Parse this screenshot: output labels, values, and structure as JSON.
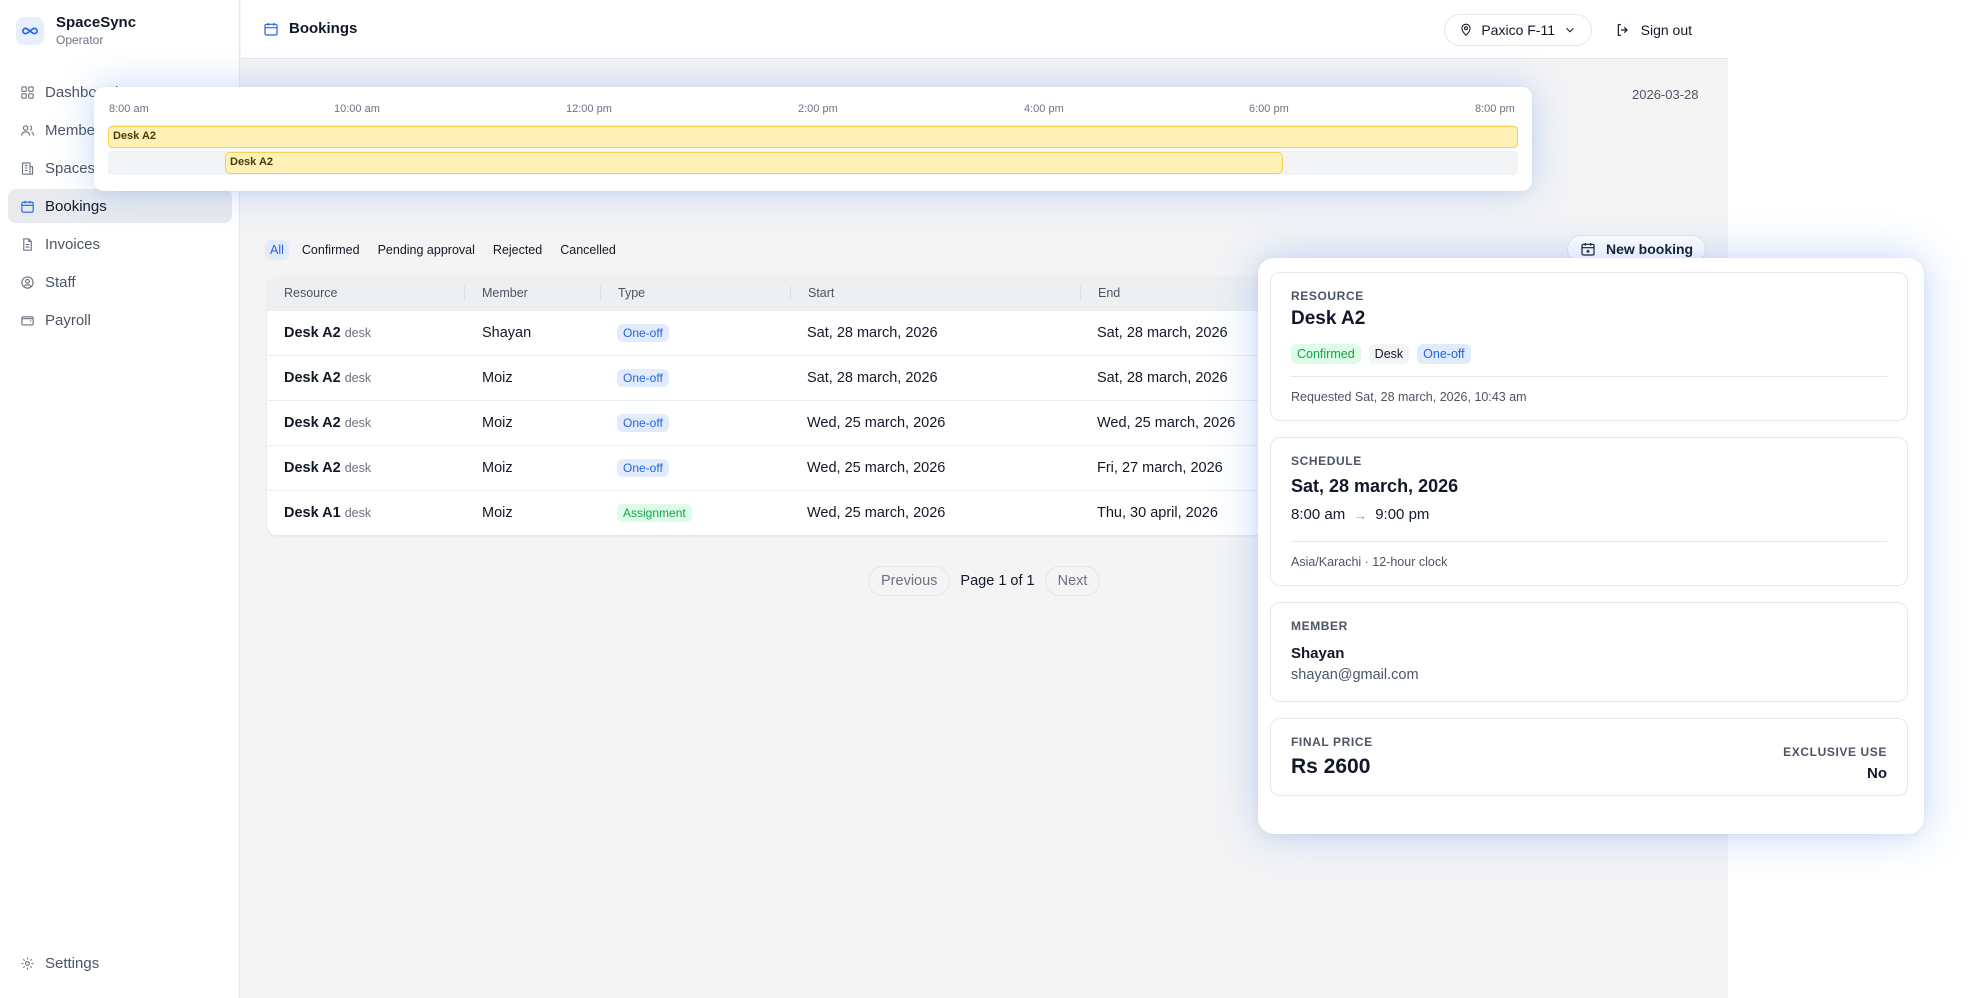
{
  "brand": {
    "name": "SpaceSync",
    "role": "Operator"
  },
  "sidebar": {
    "items": [
      {
        "label": "Dashboard",
        "icon": "grid-icon"
      },
      {
        "label": "Members",
        "icon": "users-icon"
      },
      {
        "label": "Spaces",
        "icon": "building-icon"
      },
      {
        "label": "Bookings",
        "icon": "calendar-icon",
        "active": true
      },
      {
        "label": "Invoices",
        "icon": "document-icon"
      },
      {
        "label": "Staff",
        "icon": "user-circle-icon"
      },
      {
        "label": "Payroll",
        "icon": "wallet-icon"
      }
    ],
    "settings_label": "Settings"
  },
  "header": {
    "title": "Bookings",
    "location": "Paxico F-11",
    "signout_label": "Sign out"
  },
  "timeline": {
    "date": "2026-03-28",
    "ticks": [
      "8:00 am",
      "10:00 am",
      "12:00 pm",
      "2:00 pm",
      "4:00 pm",
      "6:00 pm",
      "8:00 pm"
    ],
    "bookings": [
      {
        "label": "Desk A2",
        "start": "8:00 am",
        "end": "8:00 pm"
      },
      {
        "label": "Desk A2",
        "start": "9:00 am",
        "end": "6:00 pm"
      }
    ]
  },
  "filters": [
    "All",
    "Confirmed",
    "Pending approval",
    "Rejected",
    "Cancelled"
  ],
  "new_booking_label": "New booking",
  "table": {
    "columns": [
      "Resource",
      "Member",
      "Type",
      "Start",
      "End"
    ],
    "rows": [
      {
        "resource": "Desk A2",
        "kind": "desk",
        "member": "Shayan",
        "type": "One-off",
        "start": "Sat, 28 march, 2026",
        "end": "Sat, 28 march, 2026"
      },
      {
        "resource": "Desk A2",
        "kind": "desk",
        "member": "Moiz",
        "type": "One-off",
        "start": "Sat, 28 march, 2026",
        "end": "Sat, 28 march, 2026"
      },
      {
        "resource": "Desk A2",
        "kind": "desk",
        "member": "Moiz",
        "type": "One-off",
        "start": "Wed, 25 march, 2026",
        "end": "Wed, 25 march, 2026"
      },
      {
        "resource": "Desk A2",
        "kind": "desk",
        "member": "Moiz",
        "type": "One-off",
        "start": "Wed, 25 march, 2026",
        "end": "Fri, 27 march, 2026"
      },
      {
        "resource": "Desk A1",
        "kind": "desk",
        "member": "Moiz",
        "type": "Assignment",
        "start": "Wed, 25 march, 2026",
        "end": "Thu, 30 april, 2026"
      }
    ]
  },
  "pagination": {
    "previous": "Previous",
    "page_text": "Page 1 of 1",
    "next": "Next"
  },
  "detail": {
    "resource": {
      "label": "RESOURCE",
      "name": "Desk A2",
      "status": "Confirmed",
      "kind": "Desk",
      "type": "One-off",
      "requested": "Requested Sat, 28 march, 2026, 10:43 am"
    },
    "schedule": {
      "label": "SCHEDULE",
      "date": "Sat, 28 march, 2026",
      "start": "8:00 am",
      "end": "9:00 pm",
      "timezone": "Asia/Karachi · 12-hour clock"
    },
    "member": {
      "label": "MEMBER",
      "name": "Shayan",
      "email": "shayan@gmail.com"
    },
    "price": {
      "label": "FINAL PRICE",
      "value": "Rs 2600",
      "exclusive_label": "EXCLUSIVE USE",
      "exclusive_value": "No"
    }
  },
  "colors": {
    "accent": "#2563eb",
    "timeline_bar": "#fdf1b8",
    "confirmed": "#16a34a"
  }
}
